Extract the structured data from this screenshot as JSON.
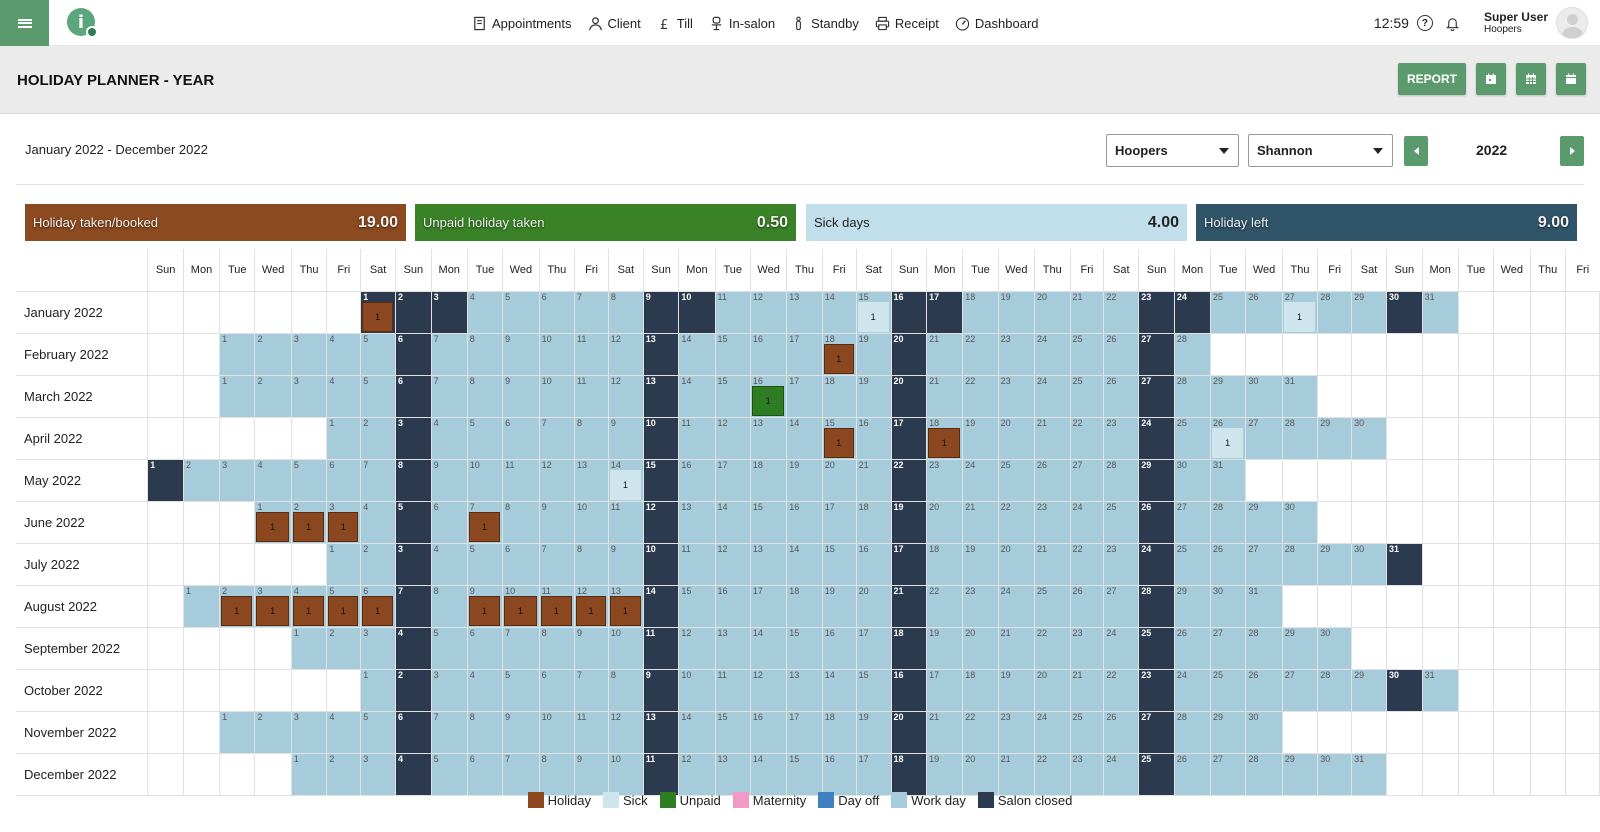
{
  "topbar": {
    "nav": [
      {
        "label": "Appointments",
        "icon": "book-icon"
      },
      {
        "label": "Client",
        "icon": "person-icon"
      },
      {
        "label": "Till",
        "icon": "pound-icon"
      },
      {
        "label": "In-salon",
        "icon": "chair-icon"
      },
      {
        "label": "Standby",
        "icon": "standing-person-icon"
      },
      {
        "label": "Receipt",
        "icon": "printer-icon"
      },
      {
        "label": "Dashboard",
        "icon": "gauge-icon"
      }
    ],
    "clock": "12:59",
    "user_name": "Super User",
    "user_company": "Hoopers"
  },
  "header": {
    "title": "HOLIDAY PLANNER - YEAR",
    "report_label": "REPORT"
  },
  "filters": {
    "range_text": "January 2022 - December 2022",
    "salon": "Hoopers",
    "staff": "Shannon",
    "year": "2022"
  },
  "summary": [
    {
      "label": "Holiday taken/booked",
      "value": "19.00",
      "color": "#8b4a1f"
    },
    {
      "label": "Unpaid holiday taken",
      "value": "0.50",
      "color": "#3a8227"
    },
    {
      "label": "Sick days",
      "value": "4.00",
      "color": "#c1dfea"
    },
    {
      "label": "Holiday left",
      "value": "9.00",
      "color": "#305468"
    }
  ],
  "weekdays": [
    "Sun",
    "Mon",
    "Tue",
    "Wed",
    "Thu",
    "Fri",
    "Sat",
    "Sun",
    "Mon",
    "Tue",
    "Wed",
    "Thu",
    "Fri",
    "Sat",
    "Sun",
    "Mon",
    "Tue",
    "Wed",
    "Thu",
    "Fri",
    "Sat",
    "Sun",
    "Mon",
    "Tue",
    "Wed",
    "Thu",
    "Fri",
    "Sat",
    "Sun",
    "Mon",
    "Tue",
    "Wed",
    "Thu",
    "Fri",
    "Sat",
    "Sun",
    "Mon",
    "Tue",
    "Wed",
    "Thu",
    "Fri"
  ],
  "months": [
    {
      "name": "January 2022",
      "start": 6,
      "days": 31
    },
    {
      "name": "February 2022",
      "start": 2,
      "days": 28
    },
    {
      "name": "March 2022",
      "start": 2,
      "days": 31
    },
    {
      "name": "April 2022",
      "start": 5,
      "days": 30
    },
    {
      "name": "May 2022",
      "start": 0,
      "days": 31
    },
    {
      "name": "June 2022",
      "start": 3,
      "days": 30
    },
    {
      "name": "July 2022",
      "start": 5,
      "days": 31
    },
    {
      "name": "August 2022",
      "start": 1,
      "days": 31
    },
    {
      "name": "September 2022",
      "start": 4,
      "days": 30
    },
    {
      "name": "October 2022",
      "start": 6,
      "days": 31
    },
    {
      "name": "November 2022",
      "start": 2,
      "days": 30
    },
    {
      "name": "December 2022",
      "start": 4,
      "days": 31
    }
  ],
  "salon_closed_extra": {
    "0": [
      1,
      2,
      3,
      9,
      10,
      17,
      23,
      24
    ]
  },
  "entries": [
    {
      "m": 0,
      "d": 1,
      "type": "hol",
      "label": "1"
    },
    {
      "m": 0,
      "d": 15,
      "type": "sick",
      "label": "1"
    },
    {
      "m": 0,
      "d": 27,
      "type": "sick",
      "label": "1"
    },
    {
      "m": 1,
      "d": 18,
      "type": "hol",
      "label": "1"
    },
    {
      "m": 2,
      "d": 16,
      "type": "unp",
      "label": "1"
    },
    {
      "m": 3,
      "d": 15,
      "type": "hol",
      "label": "1"
    },
    {
      "m": 3,
      "d": 18,
      "type": "hol",
      "label": "1"
    },
    {
      "m": 3,
      "d": 26,
      "type": "sick",
      "label": "1"
    },
    {
      "m": 4,
      "d": 14,
      "type": "sick",
      "label": "1"
    },
    {
      "m": 5,
      "d": 1,
      "type": "hol",
      "label": "1"
    },
    {
      "m": 5,
      "d": 2,
      "type": "hol",
      "label": "1"
    },
    {
      "m": 5,
      "d": 3,
      "type": "hol",
      "label": "1"
    },
    {
      "m": 5,
      "d": 7,
      "type": "hol",
      "label": "1"
    },
    {
      "m": 7,
      "d": 2,
      "type": "hol",
      "label": "1"
    },
    {
      "m": 7,
      "d": 3,
      "type": "hol",
      "label": "1"
    },
    {
      "m": 7,
      "d": 4,
      "type": "hol",
      "label": "1"
    },
    {
      "m": 7,
      "d": 5,
      "type": "hol",
      "label": "1"
    },
    {
      "m": 7,
      "d": 6,
      "type": "hol",
      "label": "1"
    },
    {
      "m": 7,
      "d": 9,
      "type": "hol",
      "label": "1"
    },
    {
      "m": 7,
      "d": 10,
      "type": "hol",
      "label": "1"
    },
    {
      "m": 7,
      "d": 11,
      "type": "hol",
      "label": "1"
    },
    {
      "m": 7,
      "d": 12,
      "type": "hol",
      "label": "1"
    },
    {
      "m": 7,
      "d": 13,
      "type": "hol",
      "label": "1"
    }
  ],
  "legend": [
    {
      "label": "Holiday",
      "color": "#8b4820"
    },
    {
      "label": "Sick",
      "color": "#cfe5ee"
    },
    {
      "label": "Unpaid",
      "color": "#2f7d22"
    },
    {
      "label": "Maternity",
      "color": "#f29ac6"
    },
    {
      "label": "Day off",
      "color": "#3f7fc2"
    },
    {
      "label": "Work day",
      "color": "#a6cbdb"
    },
    {
      "label": "Salon closed",
      "color": "#2c3a4f"
    }
  ]
}
